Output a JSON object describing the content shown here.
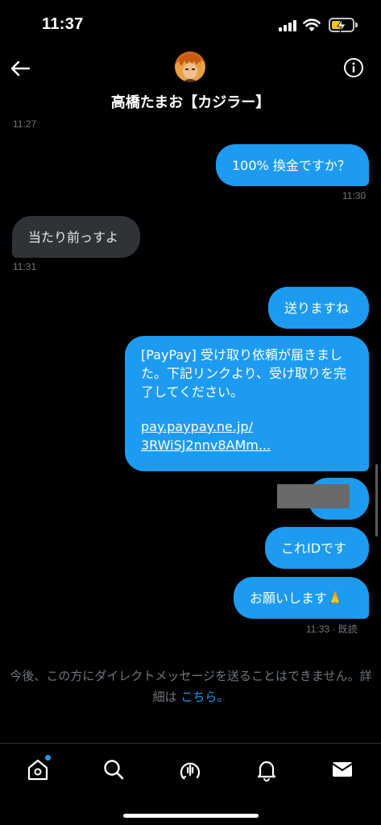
{
  "status": {
    "time": "11:37"
  },
  "header": {
    "name": "高橋たまお【カジラー】"
  },
  "messages": {
    "ts_top": "11:27",
    "m1": "100% 換金ですか？",
    "ts1": "11:30",
    "m2": "当たり前っすよ",
    "ts2": "11:31",
    "m3": "送りますね",
    "m4_text": "[PayPay] 受け取り依頼が届きました。下記リンクより、受け取りを完了してください。",
    "m4_link": "pay.paypay.ne.jp/ 3RWiSJ2nnv8AMm...",
    "m6": "これIDです",
    "m7": "お願いします🙏",
    "ts_last": "11:33 · 既読"
  },
  "notice": {
    "text": "今後、この方にダイレクトメッセージを送ることはできません。詳細は",
    "link": "こちら。"
  },
  "icons": [
    "back-arrow-icon",
    "info-icon",
    "home-icon",
    "search-icon",
    "spaces-icon",
    "bell-icon",
    "mail-icon"
  ],
  "colors": {
    "accent": "#1d9bf0",
    "incoming": "#2f3336",
    "muted": "#71767b"
  }
}
